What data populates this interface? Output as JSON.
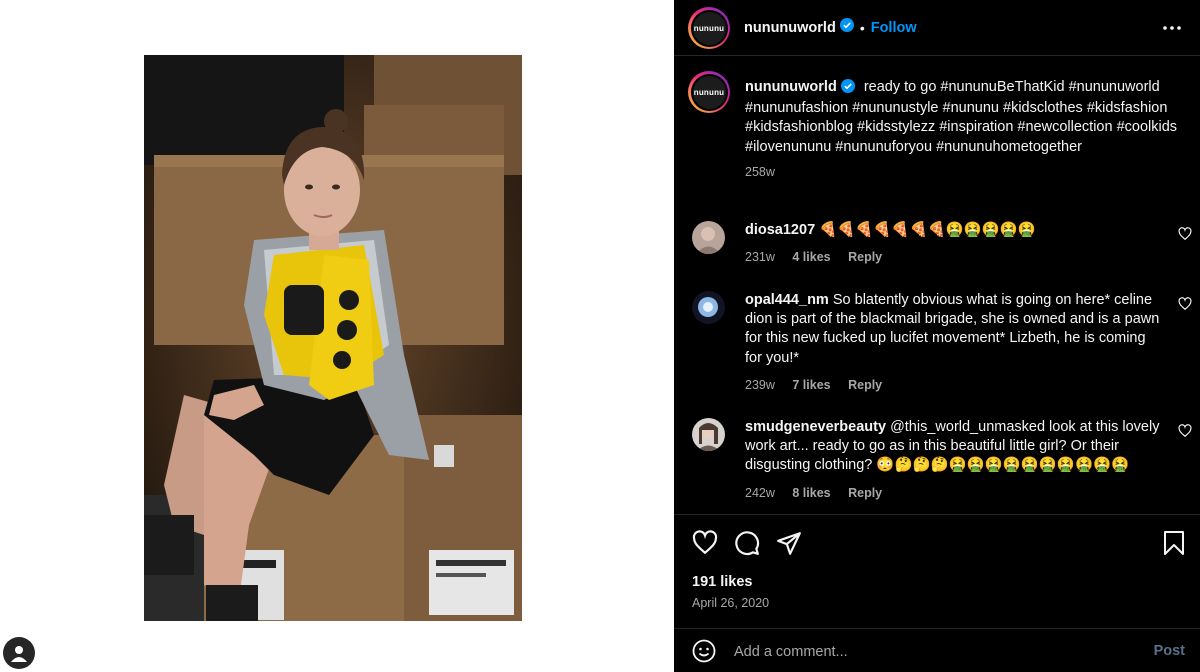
{
  "post": {
    "author": "nununuworld",
    "avatar_logo_text": "nununu",
    "follow_label": "Follow",
    "separator": "•",
    "caption_text": "ready to go #nununuBeThatKid #nununuworld #nununufashion #nununustyle #nununu #kidsclothes #kidsfashion #kidsfashionblog #kidsstylezz #inspiration #newcollection #coolkids #ilovenununu #nununuforyou #nununuhometogether",
    "caption_age": "258w",
    "likes": "191 likes",
    "date": "April 26, 2020"
  },
  "comments": [
    {
      "username": "diosa1207",
      "text": "🍕🍕🍕🍕🍕🍕🍕🤮🤮🤮🤮🤮",
      "age": "231w",
      "likes": "4 likes",
      "reply": "Reply"
    },
    {
      "username": "opal444_nm",
      "text": "So blatently obvious what is going on here* celine dion is part of the blackmail brigade, she is owned and is a pawn for this new fucked up lucifet movement* Lizbeth, he is coming for you!*",
      "age": "239w",
      "likes": "7 likes",
      "reply": "Reply"
    },
    {
      "username": "smudgeneverbeauty",
      "text": "@this_world_unmasked look at this lovely work art... ready to go as in this beautiful little girl? Or their disgusting clothing? 😳🤔🤔🤔🤮🤮🤮🤮🤮🤮🤮🤮🤮🤮",
      "age": "242w",
      "likes": "8 likes",
      "reply": "Reply"
    }
  ],
  "add_comment": {
    "placeholder": "Add a comment...",
    "post_label": "Post"
  },
  "colors": {
    "panel_bg": "#000000",
    "accent_blue": "#0095f6",
    "muted_text": "#a8a8a8"
  },
  "icons": [
    "more-icon",
    "verified-icon",
    "heart-icon",
    "comment-icon",
    "share-icon",
    "bookmark-icon",
    "emoji-icon",
    "user-icon"
  ]
}
